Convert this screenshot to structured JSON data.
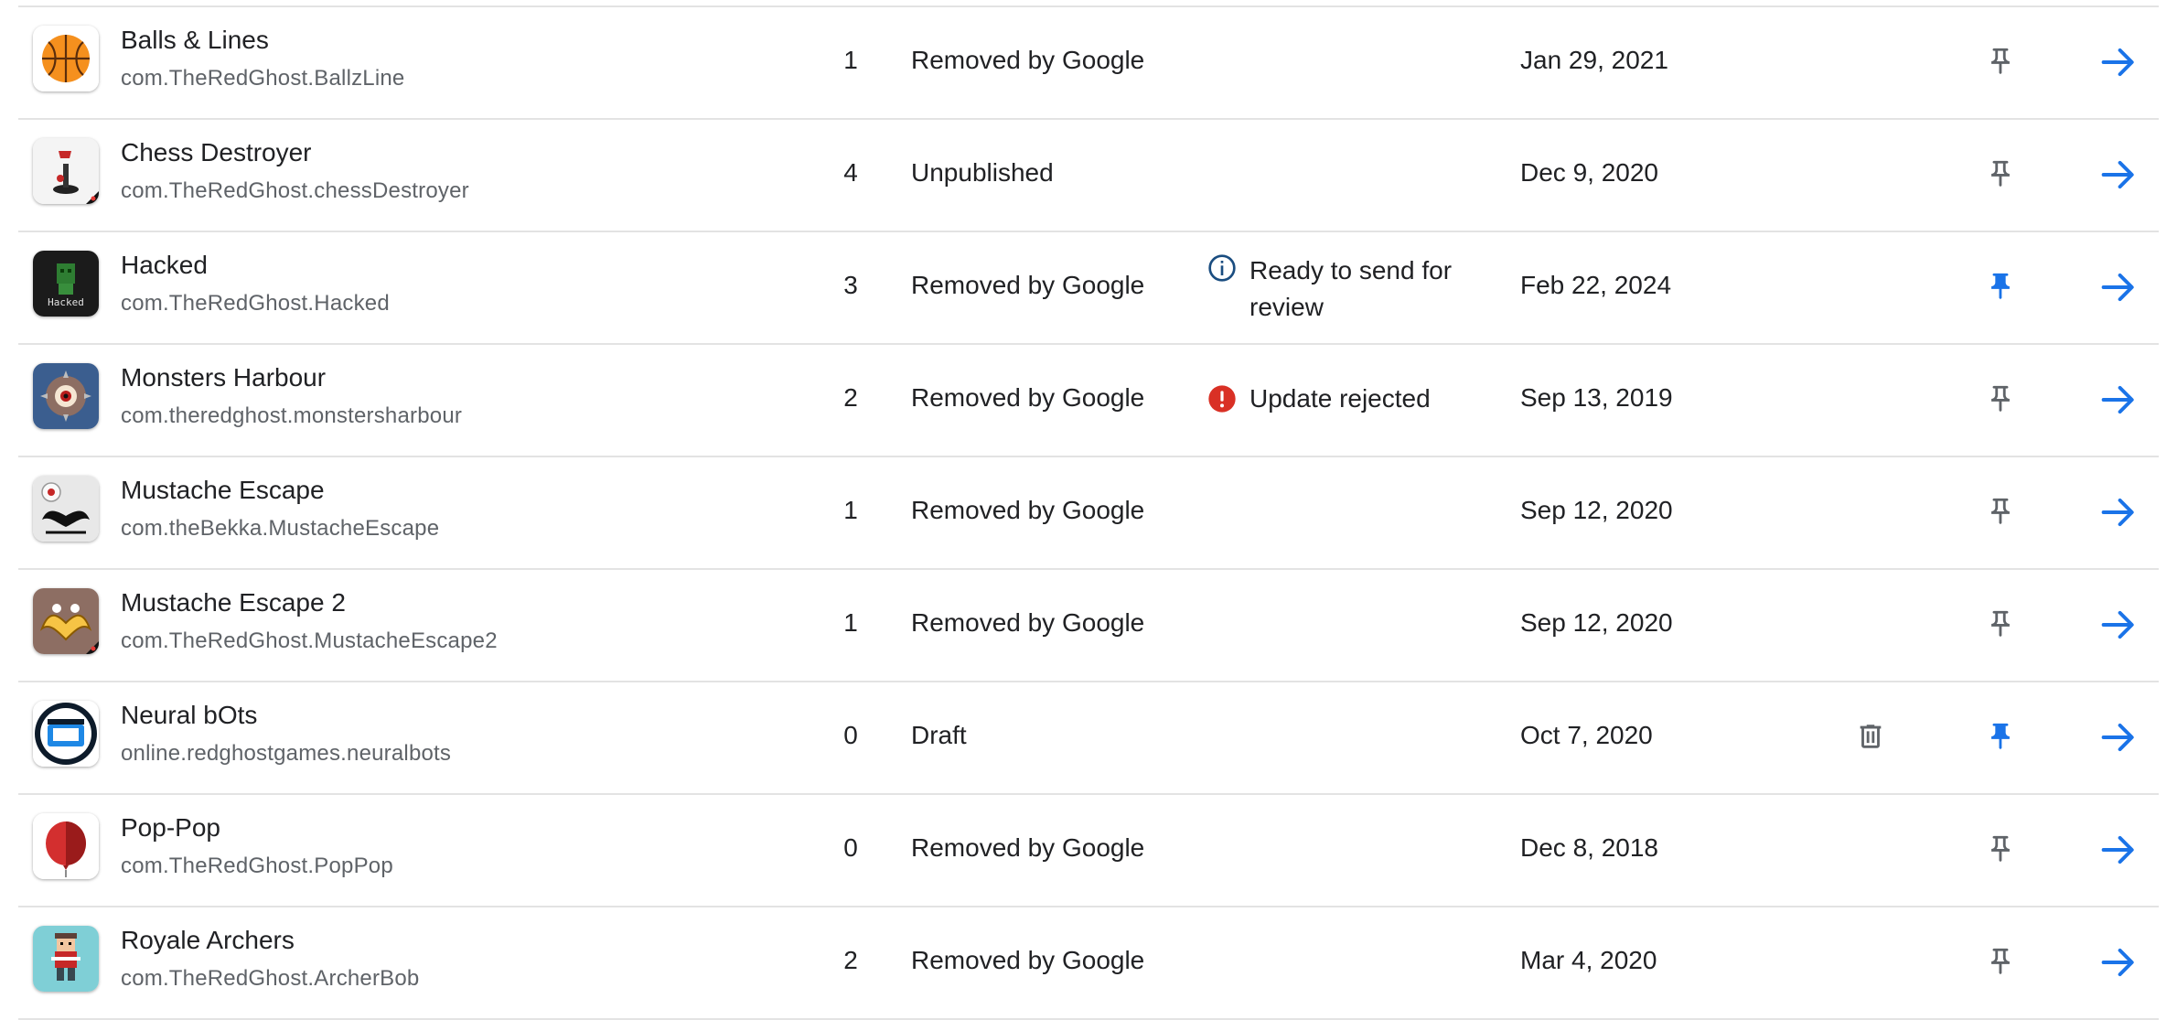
{
  "colors": {
    "accent": "#1a73e8",
    "pin_inactive": "#5f6368",
    "error": "#d93025",
    "info": "#1a4d80",
    "divider": "#e3e3e3"
  },
  "apps": [
    {
      "name": "Balls & Lines",
      "package": "com.TheRedGhost.BallzLine",
      "count": "1",
      "status": "Removed by Google",
      "update_status": "",
      "date": "Jan 29, 2021",
      "pinned": false,
      "deletable": false,
      "icon": "basketball-icon"
    },
    {
      "name": "Chess Destroyer",
      "package": "com.TheRedGhost.chessDestroyer",
      "count": "4",
      "status": "Unpublished",
      "update_status": "",
      "date": "Dec 9, 2020",
      "pinned": false,
      "deletable": false,
      "icon": "chess-joystick-icon"
    },
    {
      "name": "Hacked",
      "package": "com.TheRedGhost.Hacked",
      "count": "3",
      "status": "Removed by Google",
      "update_status": "Ready to send for review",
      "update_type": "info",
      "date": "Feb 22, 2024",
      "pinned": true,
      "deletable": false,
      "icon": "hacked-icon"
    },
    {
      "name": "Monsters Harbour",
      "package": "com.theredghost.monstersharbour",
      "count": "2",
      "status": "Removed by Google",
      "update_status": "Update rejected",
      "update_type": "error",
      "date": "Sep 13, 2019",
      "pinned": false,
      "deletable": false,
      "icon": "monster-eye-icon"
    },
    {
      "name": "Mustache Escape",
      "package": "com.theBekka.MustacheEscape",
      "count": "1",
      "status": "Removed by Google",
      "update_status": "",
      "date": "Sep 12, 2020",
      "pinned": false,
      "deletable": false,
      "icon": "mustache-icon"
    },
    {
      "name": "Mustache Escape 2",
      "package": "com.TheRedGhost.MustacheEscape2",
      "count": "1",
      "status": "Removed by Google",
      "update_status": "",
      "date": "Sep 12, 2020",
      "pinned": false,
      "deletable": false,
      "icon": "golden-mustache-icon"
    },
    {
      "name": "Neural bOts",
      "package": "online.redghostgames.neuralbots",
      "count": "0",
      "status": "Draft",
      "update_status": "",
      "date": "Oct 7, 2020",
      "pinned": true,
      "deletable": true,
      "icon": "neural-bot-icon"
    },
    {
      "name": "Pop-Pop",
      "package": "com.TheRedGhost.PopPop",
      "count": "0",
      "status": "Removed by Google",
      "update_status": "",
      "date": "Dec 8, 2018",
      "pinned": false,
      "deletable": false,
      "icon": "balloon-icon"
    },
    {
      "name": "Royale Archers",
      "package": "com.TheRedGhost.ArcherBob",
      "count": "2",
      "status": "Removed by Google",
      "update_status": "",
      "date": "Mar 4, 2020",
      "pinned": false,
      "deletable": false,
      "icon": "archer-icon"
    }
  ]
}
